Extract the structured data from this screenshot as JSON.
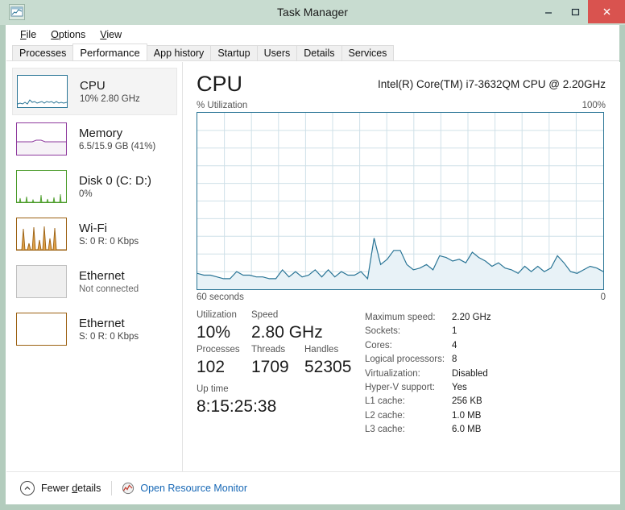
{
  "window": {
    "title": "Task Manager",
    "icon": "task-manager-icon",
    "minimize": "–",
    "maximize": "❐",
    "close": "✕"
  },
  "menubar": {
    "items": [
      {
        "label": "File",
        "accel": "F"
      },
      {
        "label": "Options",
        "accel": "O"
      },
      {
        "label": "View",
        "accel": "V"
      }
    ]
  },
  "tabs": [
    {
      "label": "Processes",
      "active": false
    },
    {
      "label": "Performance",
      "active": true
    },
    {
      "label": "App history",
      "active": false
    },
    {
      "label": "Startup",
      "active": false
    },
    {
      "label": "Users",
      "active": false
    },
    {
      "label": "Details",
      "active": false
    },
    {
      "label": "Services",
      "active": false
    }
  ],
  "sidebar": {
    "items": [
      {
        "name": "CPU",
        "title": "CPU",
        "sub": "10% 2.80 GHz",
        "color": "#2a7596",
        "selected": true
      },
      {
        "name": "Memory",
        "title": "Memory",
        "sub": "6.5/15.9 GB (41%)",
        "color": "#8e3a9e",
        "selected": false
      },
      {
        "name": "Disk 0",
        "title": "Disk 0 (C: D:)",
        "sub": "0%",
        "color": "#4a9b29",
        "selected": false
      },
      {
        "name": "Wi-Fi",
        "title": "Wi-Fi",
        "sub": "S: 0 R: 0 Kbps",
        "color": "#9c6112",
        "selected": false
      },
      {
        "name": "Ethernet disconnected",
        "title": "Ethernet",
        "sub": "Not connected",
        "color": "#b8b8b8",
        "selected": false
      },
      {
        "name": "Ethernet",
        "title": "Ethernet",
        "sub": "S: 0 R: 0 Kbps",
        "color": "#9c6112",
        "selected": false
      }
    ]
  },
  "main": {
    "heading": "CPU",
    "model": "Intel(R) Core(TM) i7-3632QM CPU @ 2.20GHz",
    "graph_label_left": "% Utilization",
    "graph_label_right": "100%",
    "graph_foot_left": "60 seconds",
    "graph_foot_right": "0",
    "stats": {
      "utilization_label": "Utilization",
      "utilization_value": "10%",
      "speed_label": "Speed",
      "speed_value": "2.80 GHz",
      "processes_label": "Processes",
      "processes_value": "102",
      "threads_label": "Threads",
      "threads_value": "1709",
      "handles_label": "Handles",
      "handles_value": "52305",
      "uptime_label": "Up time",
      "uptime_value": "8:15:25:38"
    },
    "specs": [
      {
        "key": "Maximum speed:",
        "value": "2.20 GHz"
      },
      {
        "key": "Sockets:",
        "value": "1"
      },
      {
        "key": "Cores:",
        "value": "4"
      },
      {
        "key": "Logical processors:",
        "value": "8"
      },
      {
        "key": "Virtualization:",
        "value": "Disabled"
      },
      {
        "key": "Hyper-V support:",
        "value": "Yes"
      },
      {
        "key": "L1 cache:",
        "value": "256 KB"
      },
      {
        "key": "L2 cache:",
        "value": "1.0 MB"
      },
      {
        "key": "L3 cache:",
        "value": "6.0 MB"
      }
    ]
  },
  "footer": {
    "fewer_details": "Fewer details",
    "fewer_details_accel": "d",
    "open_resource_monitor": "Open Resource Monitor",
    "chevron_icon": "chevron-up-icon",
    "resmon_icon": "resource-monitor-icon"
  },
  "colors": {
    "accent": "#2a7596",
    "titlebar": "#c8dcd0",
    "window_border": "#b3ccbd",
    "close_button": "#d9534f",
    "link": "#1667b5",
    "graph_fill": "#e8f2f7",
    "grid": "#cfe0e8"
  },
  "chart_data": {
    "type": "area",
    "title": "CPU % Utilization",
    "ylabel": "% Utilization",
    "xlabel": "60 seconds",
    "ylim": [
      0,
      100
    ],
    "xlim": [
      60,
      0
    ],
    "grid": true,
    "series": [
      {
        "name": "CPU utilization",
        "color": "#2a7596",
        "values": [
          9,
          8,
          8,
          7,
          6,
          6,
          10,
          8,
          8,
          7,
          7,
          6,
          6,
          11,
          7,
          10,
          7,
          8,
          11,
          7,
          11,
          7,
          10,
          8,
          8,
          10,
          6,
          29,
          14,
          17,
          22,
          22,
          14,
          11,
          12,
          14,
          11,
          19,
          18,
          16,
          17,
          15,
          21,
          18,
          16,
          13,
          15,
          12,
          11,
          9,
          13,
          10,
          13,
          10,
          12,
          19,
          15,
          10,
          9,
          11,
          13,
          12,
          10
        ]
      }
    ]
  }
}
